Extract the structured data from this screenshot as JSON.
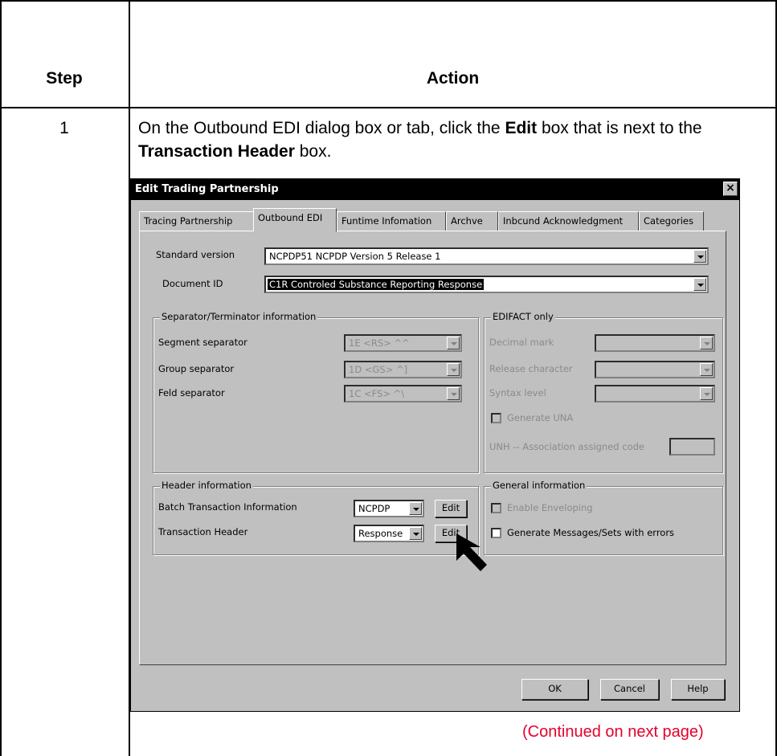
{
  "table": {
    "header_step": "Step",
    "header_action": "Action",
    "step_number": "1",
    "instruction_1": "On the Outbound EDI dialog box or tab, click the ",
    "instruction_edit": "Edit",
    "instruction_2": " box that is next to the ",
    "instruction_th": "Transaction Header",
    "instruction_3": " box.",
    "continued": "(Continued on next page)"
  },
  "dialog": {
    "title": "Edit Trading Partnership",
    "close_glyph": "×",
    "tabs": [
      {
        "label": "Tracing Partnership"
      },
      {
        "label": "Outbound EDI"
      },
      {
        "label": "Funtime Infomation"
      },
      {
        "label": "Archve"
      },
      {
        "label": "Inbcund Acknowledgment"
      },
      {
        "label": "Categories"
      }
    ],
    "standard_version_label": "Standard version",
    "standard_version_value": "NCPDP51    NCPDP Version 5 Release 1",
    "document_id_label": "Document ID",
    "document_id_value": "C1R    Controled Substance Reporting Response",
    "separator_group": {
      "title": "Separator/Terminator information",
      "segment_label": "Segment separator",
      "segment_value": "1E <RS> ^^",
      "group_label": "Group separator",
      "group_value": "1D <GS> ^]",
      "field_label": "Feld separator",
      "field_value": "1C <FS> ^\\"
    },
    "edifact_group": {
      "title": "EDIFACT only",
      "decimal_label": "Decimal mark",
      "release_label": "Release character",
      "syntax_label": "Syntax level",
      "generate_una_label": "Generate UNA",
      "unh_label": "UNH -- Association assigned code"
    },
    "header_group": {
      "title": "Header information",
      "batch_label": "Batch Transaction Information",
      "batch_value": "NCPDP",
      "transaction_label": "Transaction Header",
      "transaction_value": "Response",
      "edit_label": "Edit"
    },
    "general_group": {
      "title": "General information",
      "enable_label": "Enable Enveloping",
      "generate_label": "Generate Messages/Sets with errors"
    },
    "ok_label": "OK",
    "cancel_label": "Cancel",
    "help_label": "Help"
  }
}
